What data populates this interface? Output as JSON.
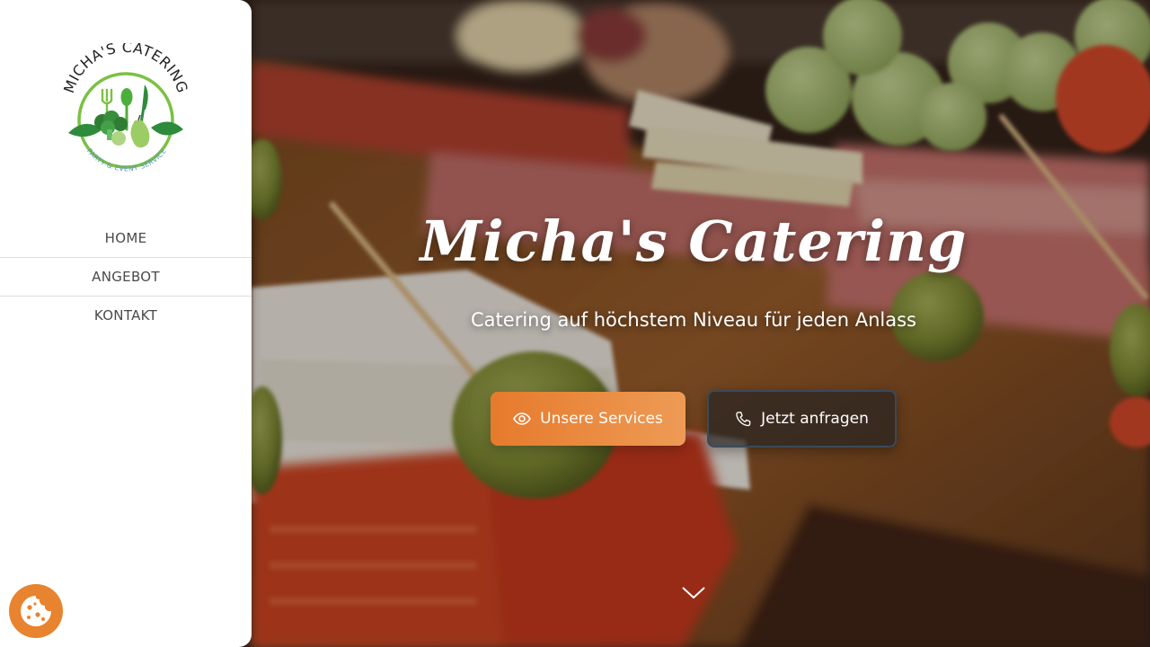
{
  "brand": {
    "logo_text": "MICHA'S CATERING",
    "logo_tagline": "PARTY & EVENT SERVICE"
  },
  "sidebar": {
    "items": [
      {
        "label": "HOME"
      },
      {
        "label": "ANGEBOT"
      },
      {
        "label": "KONTAKT"
      }
    ]
  },
  "hero": {
    "title": "Micha's Catering",
    "subtitle": "Catering auf höchstem Niveau für jeden Anlass",
    "primary_button": {
      "label": "Unsere Services",
      "icon": "eye-icon"
    },
    "secondary_button": {
      "label": "Jetzt anfragen",
      "icon": "phone-icon"
    },
    "scroll_icon": "chevron-down-icon"
  },
  "cookie": {
    "icon": "cookie-icon"
  },
  "colors": {
    "accent_orange": "#e8832f",
    "logo_green": "#7ac143",
    "logo_blue": "#5b8fc9",
    "nav_text": "#4a4a4a"
  }
}
